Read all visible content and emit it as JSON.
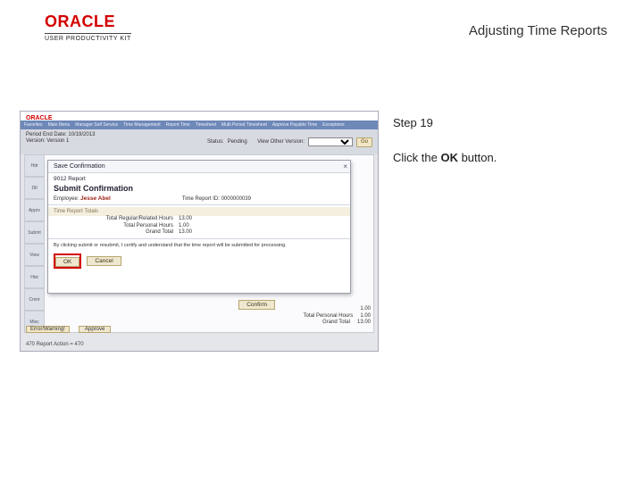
{
  "header": {
    "brand": "ORACLE",
    "brand_sub": "USER PRODUCTIVITY KIT",
    "title": "Adjusting Time Reports"
  },
  "instruction": {
    "step_label": "Step 19",
    "line_a": "Click the ",
    "bold": "OK",
    "line_b": " button."
  },
  "app": {
    "brand": "ORACLE",
    "nav": [
      "Favorites",
      "Main Menu",
      "Manager Self Service",
      "Time Management",
      "Report Time",
      "Timesheet",
      "Multi Period Timesheet",
      "Approve Payable Time",
      "Exceptions"
    ],
    "context": {
      "period_lbl": "Period End Date:",
      "period_val": "10/19/2013",
      "version_lbl": "Version:",
      "version_val": "Version 1",
      "status_lbl": "Status:",
      "status_val": "Pending",
      "view_lbl": "View Other Version:",
      "select_placeholder": "",
      "go": "Go"
    },
    "tabs": [
      "Hdr",
      "Dtl",
      "Apprv",
      "Submt",
      "View",
      "Hist",
      "Cmnt",
      "Misc"
    ],
    "dialog": {
      "title": "Save Confirmation",
      "close": "×",
      "section": "9012 Report",
      "heading": "Submit Confirmation",
      "emp_lbl": "Employee:",
      "emp_val": "Jesse Abel",
      "tr_lbl": "Time Report ID:",
      "tr_val": "0000000039",
      "detail_hdr": "Time Report Totals",
      "k1": "Total Regular/Related Hours",
      "v1": "13.00",
      "k2": "Total Personal Hours",
      "v2": "1.00",
      "k3": "Grand Total",
      "v3": "13.00",
      "confirm_line": "By clicking submit or resubmit, I certify and understand that the time report will be submitted for processing.",
      "ok": "OK",
      "cancel": "Cancel"
    },
    "confirm_btn": "Confirm",
    "err_hdr": "Error/Warning!",
    "status_btn": "Approve",
    "totals": {
      "l1": "1.00",
      "l2_lbl": "Total Personal Hours",
      "l2_v": "1.00",
      "l3_lbl": "Grand Total",
      "l3_v": "13.00"
    },
    "footer": "470 Report Action = 470"
  }
}
